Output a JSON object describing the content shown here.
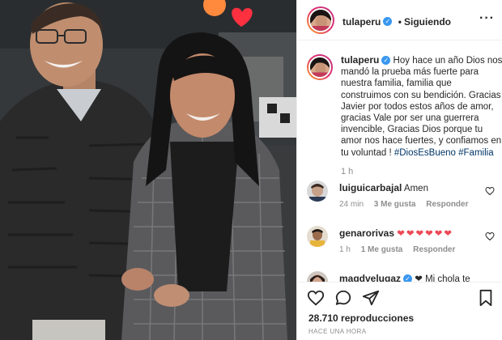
{
  "post": {
    "username": "tulaperu",
    "follow_state": "Siguiendo",
    "separator": "•",
    "more_icon": "more-dots-icon",
    "caption_text": "Hoy hace un año Dios nos mandó la prueba más fuerte para nuestra familia, familia que construimos con su bendición. Gracias Javier por todos estos años de amor, gracias Vale por ser una guerrera invencible, Gracias Dios porque tu amor nos hace fuertes, y confiamos en tu voluntad !",
    "hashtags": [
      "#DiosEsBueno",
      "#Familia"
    ],
    "caption_time": "1 h"
  },
  "comments": [
    {
      "user": "luiguicarbajal",
      "text": "Amen",
      "time": "24 min",
      "likes": "3 Me gusta",
      "reply": "Responder"
    },
    {
      "user": "genarorivas",
      "text": "",
      "emoji": "❤❤❤❤❤❤",
      "time": "1 h",
      "likes": "1 Me gusta",
      "reply": "Responder"
    },
    {
      "user": "magdvelugaz",
      "text": "❤ Mi chola te",
      "time": "",
      "likes": "",
      "reply": ""
    }
  ],
  "footer": {
    "views": "28.710 reproducciones",
    "time_ago": "HACE UNA HORA"
  },
  "colors": {
    "verified": "#3897f0",
    "heart_red": "#ed4956",
    "hashtag": "#003569",
    "muted": "#8e8e8e"
  }
}
